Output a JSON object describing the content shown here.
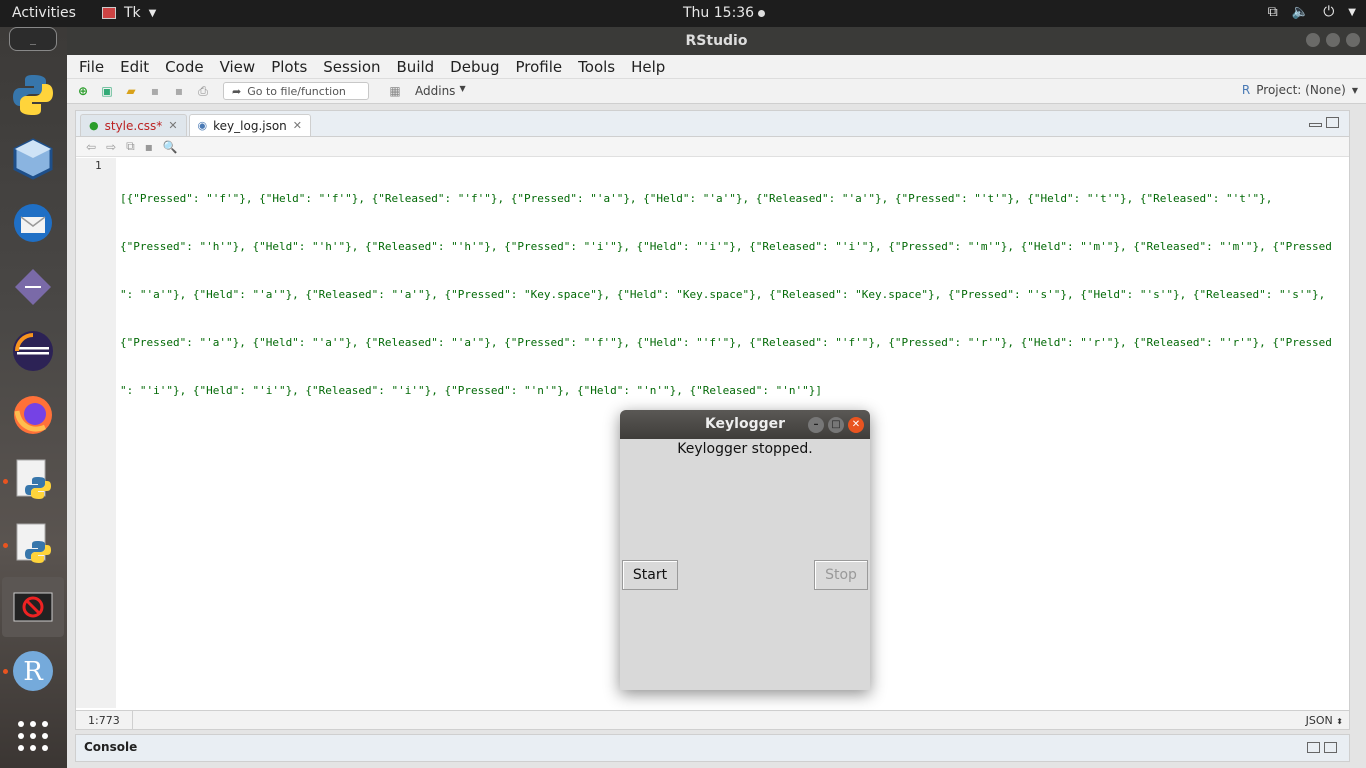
{
  "topbar": {
    "activities": "Activities",
    "app_name": "Tk",
    "clock": "Thu 15:36"
  },
  "dock": {
    "items": [
      "terminal-icon",
      "python-icon",
      "virtualbox-icon",
      "thunderbird-icon",
      "gitg-icon",
      "eclipse-icon",
      "firefox-icon",
      "python-script-icon",
      "python-script-icon",
      "tk-window-icon",
      "rstudio-icon",
      "show-apps-icon"
    ]
  },
  "window": {
    "title": "RStudio"
  },
  "menubar": {
    "items": [
      "File",
      "Edit",
      "Code",
      "View",
      "Plots",
      "Session",
      "Build",
      "Debug",
      "Profile",
      "Tools",
      "Help"
    ]
  },
  "toolbar": {
    "goto_placeholder": "Go to file/function",
    "addins": "Addins",
    "project": "Project: (None)"
  },
  "editor": {
    "tabs": [
      {
        "label": "style.css*",
        "active": false
      },
      {
        "label": "key_log.json",
        "active": true
      }
    ],
    "line_number": "1",
    "lines": [
      "[{\"Pressed\": \"'f'\"}, {\"Held\": \"'f'\"}, {\"Released\": \"'f'\"}, {\"Pressed\": \"'a'\"}, {\"Held\": \"'a'\"}, {\"Released\": \"'a'\"}, {\"Pressed\": \"'t'\"}, {\"Held\": \"'t'\"}, {\"Released\": \"'t'\"},",
      "{\"Pressed\": \"'h'\"}, {\"Held\": \"'h'\"}, {\"Released\": \"'h'\"}, {\"Pressed\": \"'i'\"}, {\"Held\": \"'i'\"}, {\"Released\": \"'i'\"}, {\"Pressed\": \"'m'\"}, {\"Held\": \"'m'\"}, {\"Released\": \"'m'\"}, {\"Pressed",
      "\": \"'a'\"}, {\"Held\": \"'a'\"}, {\"Released\": \"'a'\"}, {\"Pressed\": \"Key.space\"}, {\"Held\": \"Key.space\"}, {\"Released\": \"Key.space\"}, {\"Pressed\": \"'s'\"}, {\"Held\": \"'s'\"}, {\"Released\": \"'s'\"},",
      "{\"Pressed\": \"'a'\"}, {\"Held\": \"'a'\"}, {\"Released\": \"'a'\"}, {\"Pressed\": \"'f'\"}, {\"Held\": \"'f'\"}, {\"Released\": \"'f'\"}, {\"Pressed\": \"'r'\"}, {\"Held\": \"'r'\"}, {\"Released\": \"'r'\"}, {\"Pressed",
      "\": \"'i'\"}, {\"Held\": \"'i'\"}, {\"Released\": \"'i'\"}, {\"Pressed\": \"'n'\"}, {\"Held\": \"'n'\"}, {\"Released\": \"'n'\"}]"
    ],
    "cursor_position": "1:773",
    "file_type": "JSON"
  },
  "console": {
    "label": "Console"
  },
  "keylogger": {
    "title": "Keylogger",
    "status": "Keylogger stopped.",
    "start_label": "Start",
    "stop_label": "Stop"
  }
}
